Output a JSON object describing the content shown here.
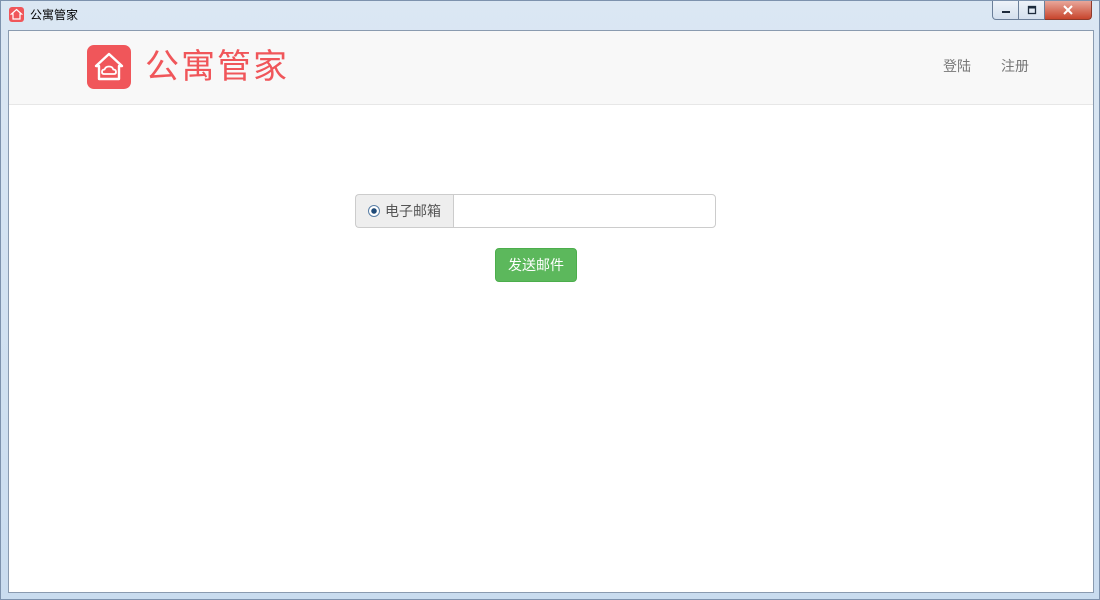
{
  "window": {
    "title": "公寓管家",
    "app_icon": "house-icon",
    "controls": {
      "minimize_icon": "minimize-icon",
      "maximize_icon": "maximize-icon",
      "close_icon": "close-icon"
    }
  },
  "navbar": {
    "brand_name": "公寓管家",
    "brand_icon": "house-cloud-icon",
    "links": [
      "登陆",
      "注册"
    ]
  },
  "form": {
    "radio_label": "电子邮箱",
    "radio_checked": true,
    "email_value": "",
    "email_placeholder": "",
    "submit_label": "发送邮件"
  },
  "colors": {
    "brand": "#f0565a",
    "success": "#5cb85c",
    "navbar_bg": "#f8f8f8"
  }
}
